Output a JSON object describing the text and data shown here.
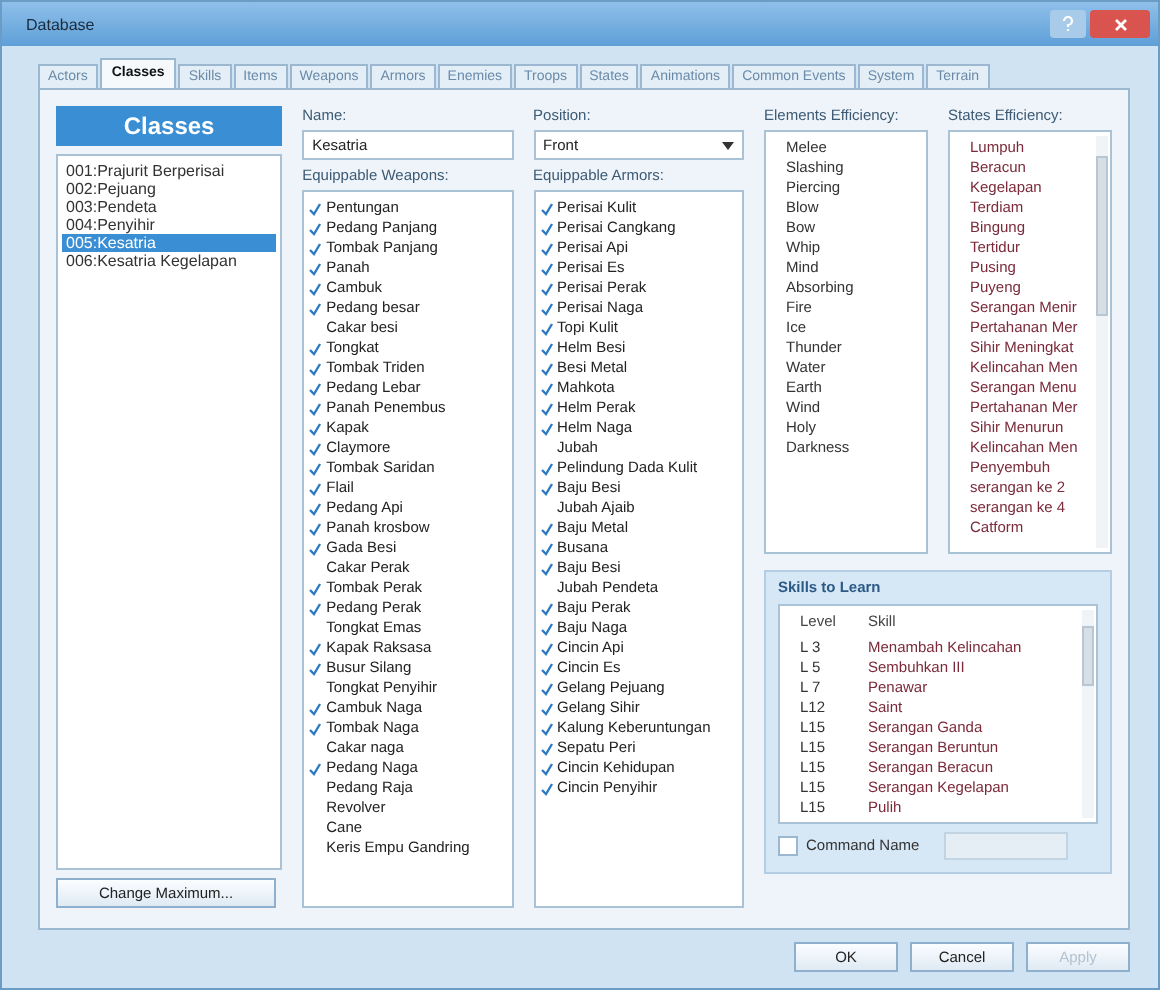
{
  "window": {
    "title": "Database"
  },
  "tabs": [
    {
      "label": "Actors",
      "selected": false
    },
    {
      "label": "Classes",
      "selected": true
    },
    {
      "label": "Skills",
      "selected": false
    },
    {
      "label": "Items",
      "selected": false
    },
    {
      "label": "Weapons",
      "selected": false
    },
    {
      "label": "Armors",
      "selected": false
    },
    {
      "label": "Enemies",
      "selected": false
    },
    {
      "label": "Troops",
      "selected": false
    },
    {
      "label": "States",
      "selected": false
    },
    {
      "label": "Animations",
      "selected": false
    },
    {
      "label": "Common Events",
      "selected": false
    },
    {
      "label": "System",
      "selected": false
    },
    {
      "label": "Terrain",
      "selected": false
    }
  ],
  "classes": {
    "header": "Classes",
    "items": [
      {
        "label": "001:Prajurit Berperisai",
        "selected": false
      },
      {
        "label": "002:Pejuang",
        "selected": false
      },
      {
        "label": "003:Pendeta",
        "selected": false
      },
      {
        "label": "004:Penyihir",
        "selected": false
      },
      {
        "label": "005:Kesatria",
        "selected": true
      },
      {
        "label": "006:Kesatria Kegelapan",
        "selected": false
      }
    ],
    "button": "Change Maximum..."
  },
  "name": {
    "label": "Name:",
    "value": "Kesatria"
  },
  "position": {
    "label": "Position:",
    "value": "Front"
  },
  "weapons": {
    "label": "Equippable Weapons:",
    "items": [
      {
        "label": "Pentungan",
        "checked": true
      },
      {
        "label": "Pedang Panjang",
        "checked": true
      },
      {
        "label": "Tombak Panjang",
        "checked": true
      },
      {
        "label": "Panah",
        "checked": true
      },
      {
        "label": "Cambuk",
        "checked": true
      },
      {
        "label": "Pedang besar",
        "checked": true
      },
      {
        "label": "Cakar besi",
        "checked": false
      },
      {
        "label": "Tongkat",
        "checked": true
      },
      {
        "label": "Tombak Triden",
        "checked": true
      },
      {
        "label": "Pedang Lebar",
        "checked": true
      },
      {
        "label": "Panah Penembus",
        "checked": true
      },
      {
        "label": "Kapak",
        "checked": true
      },
      {
        "label": "Claymore",
        "checked": true
      },
      {
        "label": "Tombak Saridan",
        "checked": true
      },
      {
        "label": "Flail",
        "checked": true
      },
      {
        "label": "Pedang Api",
        "checked": true
      },
      {
        "label": "Panah krosbow",
        "checked": true
      },
      {
        "label": "Gada Besi",
        "checked": true
      },
      {
        "label": "Cakar Perak",
        "checked": false
      },
      {
        "label": "Tombak Perak",
        "checked": true
      },
      {
        "label": "Pedang Perak",
        "checked": true
      },
      {
        "label": "Tongkat Emas",
        "checked": false
      },
      {
        "label": "Kapak Raksasa",
        "checked": true
      },
      {
        "label": "Busur Silang",
        "checked": true
      },
      {
        "label": "Tongkat Penyihir",
        "checked": false
      },
      {
        "label": "Cambuk Naga",
        "checked": true
      },
      {
        "label": "Tombak Naga",
        "checked": true
      },
      {
        "label": "Cakar naga",
        "checked": false
      },
      {
        "label": "Pedang Naga",
        "checked": true
      },
      {
        "label": "Pedang Raja",
        "checked": false
      },
      {
        "label": "Revolver",
        "checked": false
      },
      {
        "label": "Cane",
        "checked": false
      },
      {
        "label": "Keris Empu Gandring",
        "checked": false
      }
    ]
  },
  "armors": {
    "label": "Equippable Armors:",
    "items": [
      {
        "label": "Perisai Kulit",
        "checked": true
      },
      {
        "label": "Perisai Cangkang",
        "checked": true
      },
      {
        "label": "Perisai Api",
        "checked": true
      },
      {
        "label": "Perisai Es",
        "checked": true
      },
      {
        "label": "Perisai Perak",
        "checked": true
      },
      {
        "label": "Perisai Naga",
        "checked": true
      },
      {
        "label": "Topi Kulit",
        "checked": true
      },
      {
        "label": "Helm Besi",
        "checked": true
      },
      {
        "label": "Besi Metal",
        "checked": true
      },
      {
        "label": "Mahkota",
        "checked": true
      },
      {
        "label": "Helm Perak",
        "checked": true
      },
      {
        "label": "Helm Naga",
        "checked": true
      },
      {
        "label": "Jubah",
        "checked": false
      },
      {
        "label": "Pelindung Dada Kulit",
        "checked": true
      },
      {
        "label": "Baju Besi",
        "checked": true
      },
      {
        "label": "Jubah Ajaib",
        "checked": false
      },
      {
        "label": "Baju Metal",
        "checked": true
      },
      {
        "label": "Busana",
        "checked": true
      },
      {
        "label": "Baju Besi",
        "checked": true
      },
      {
        "label": "Jubah Pendeta",
        "checked": false
      },
      {
        "label": "Baju Perak",
        "checked": true
      },
      {
        "label": "Baju Naga",
        "checked": true
      },
      {
        "label": "Cincin Api",
        "checked": true
      },
      {
        "label": "Cincin Es",
        "checked": true
      },
      {
        "label": "Gelang Pejuang",
        "checked": true
      },
      {
        "label": "Gelang Sihir",
        "checked": true
      },
      {
        "label": "Kalung Keberuntungan",
        "checked": true
      },
      {
        "label": "Sepatu Peri",
        "checked": true
      },
      {
        "label": "Cincin Kehidupan",
        "checked": true
      },
      {
        "label": "Cincin Penyihir",
        "checked": true
      }
    ]
  },
  "elements": {
    "label": "Elements Efficiency:",
    "items": [
      "Melee",
      "Slashing",
      "Piercing",
      "Blow",
      "Bow",
      "Whip",
      "Mind",
      "Absorbing",
      "Fire",
      "Ice",
      "Thunder",
      "Water",
      "Earth",
      "Wind",
      "Holy",
      "Darkness"
    ]
  },
  "states": {
    "label": "States Efficiency:",
    "items": [
      "Lumpuh",
      "Beracun",
      "Kegelapan",
      "Terdiam",
      "Bingung",
      "Tertidur",
      "Pusing",
      "Puyeng",
      "Serangan Menir",
      "Pertahanan Mer",
      "Sihir Meningkat",
      "Kelincahan Men",
      "Serangan Menu",
      "Pertahanan Mer",
      "Sihir Menurun",
      "Kelincahan Men",
      "Penyembuh",
      "serangan ke 2",
      "serangan ke 4",
      "Catform"
    ]
  },
  "skills": {
    "title": "Skills to Learn",
    "columns": [
      "Level",
      "Skill"
    ],
    "rows": [
      {
        "level": "L 3",
        "skill": "Menambah Kelincahan"
      },
      {
        "level": "L 5",
        "skill": "Sembuhkan III"
      },
      {
        "level": "L 7",
        "skill": "Penawar"
      },
      {
        "level": "L12",
        "skill": "Saint"
      },
      {
        "level": "L15",
        "skill": "Serangan Ganda"
      },
      {
        "level": "L15",
        "skill": "Serangan Beruntun"
      },
      {
        "level": "L15",
        "skill": "Serangan Beracun"
      },
      {
        "level": "L15",
        "skill": "Serangan Kegelapan"
      },
      {
        "level": "L15",
        "skill": "Pulih"
      }
    ]
  },
  "command_name": {
    "label": "Command Name",
    "checked": false
  },
  "buttons": [
    {
      "label": "OK",
      "disabled": false
    },
    {
      "label": "Cancel",
      "disabled": false
    },
    {
      "label": "Apply",
      "disabled": true
    }
  ]
}
